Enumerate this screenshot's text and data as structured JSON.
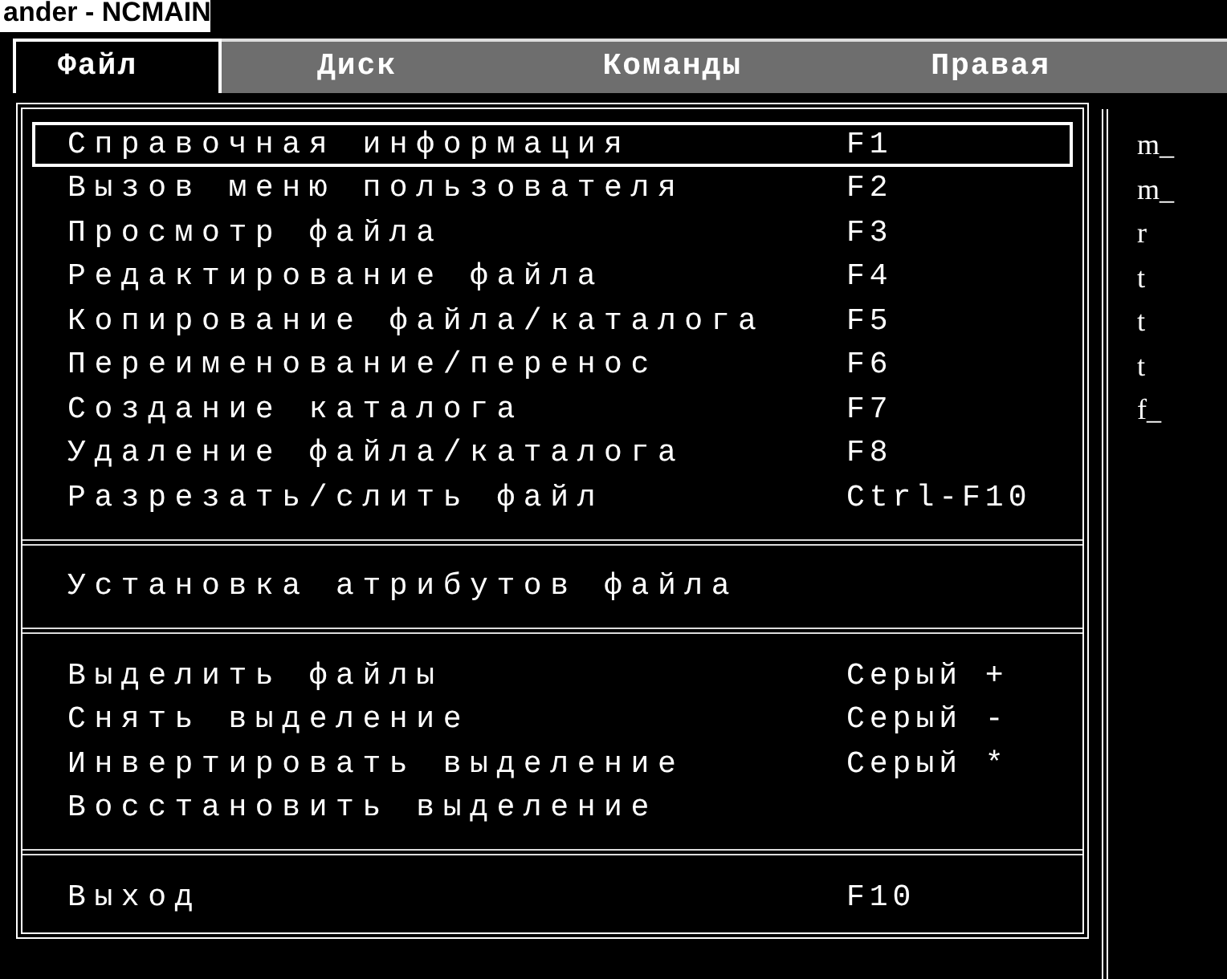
{
  "window": {
    "title": "ander - NCMAIN"
  },
  "menu_bar": [
    {
      "label": "Файл",
      "selected": true
    },
    {
      "label": "Диск",
      "selected": false
    },
    {
      "label": "Команды",
      "selected": false
    },
    {
      "label": "Правая",
      "selected": false
    }
  ],
  "menu": [
    {
      "kind": "item",
      "label": "Справочная информация",
      "key": "F1",
      "selected": true
    },
    {
      "kind": "item",
      "label": "Вызов меню пользователя",
      "key": "F2",
      "selected": false
    },
    {
      "kind": "item",
      "label": "Просмотр файла",
      "key": "F3",
      "selected": false
    },
    {
      "kind": "item",
      "label": "Редактирование файла",
      "key": "F4",
      "selected": false
    },
    {
      "kind": "item",
      "label": "Копирование файла/каталога",
      "key": "F5",
      "selected": false
    },
    {
      "kind": "item",
      "label": "Переименование/перенос",
      "key": "F6",
      "selected": false
    },
    {
      "kind": "item",
      "label": "Создание каталога",
      "key": "F7",
      "selected": false
    },
    {
      "kind": "item",
      "label": "Удаление файла/каталога",
      "key": "F8",
      "selected": false
    },
    {
      "kind": "item",
      "label": "Разрезать/слить файл",
      "key": "Ctrl-F10",
      "selected": false
    },
    {
      "kind": "separator"
    },
    {
      "kind": "item",
      "label": "Установка атрибутов файла",
      "selected": false
    },
    {
      "kind": "separator"
    },
    {
      "kind": "item",
      "label": "Выделить файлы",
      "key": "Серый +",
      "selected": false
    },
    {
      "kind": "item",
      "label": "Снять выделение",
      "key": "Серый -",
      "selected": false
    },
    {
      "kind": "item",
      "label": "Инвертировать выделение",
      "key": "Серый *",
      "selected": false
    },
    {
      "kind": "item",
      "label": "Восстановить выделение",
      "selected": false
    },
    {
      "kind": "separator"
    },
    {
      "kind": "item",
      "label": "Выход",
      "key": "F10",
      "selected": false
    }
  ],
  "right_panel": {
    "files": [
      "m_",
      "m_",
      "r",
      "t",
      "t",
      "t",
      "f_"
    ]
  }
}
